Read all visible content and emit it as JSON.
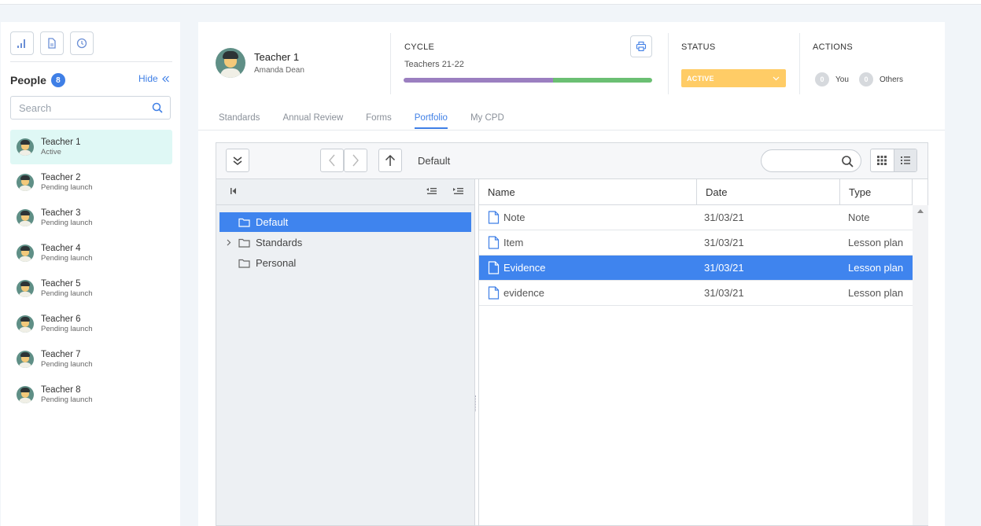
{
  "sidebar": {
    "people_label": "People",
    "people_count": "8",
    "hide_label": "Hide",
    "search_placeholder": "Search",
    "people": [
      {
        "name": "Teacher 1",
        "status": "Active"
      },
      {
        "name": "Teacher 2",
        "status": "Pending launch"
      },
      {
        "name": "Teacher 3",
        "status": "Pending launch"
      },
      {
        "name": "Teacher 4",
        "status": "Pending launch"
      },
      {
        "name": "Teacher 5",
        "status": "Pending launch"
      },
      {
        "name": "Teacher 6",
        "status": "Pending launch"
      },
      {
        "name": "Teacher 7",
        "status": "Pending launch"
      },
      {
        "name": "Teacher 8",
        "status": "Pending launch"
      }
    ]
  },
  "header": {
    "teacher_name": "Teacher 1",
    "teacher_sub": "Amanda Dean",
    "cycle_label": "CYCLE",
    "cycle_name": "Teachers 21-22",
    "status_label": "STATUS",
    "status_value": "ACTIVE",
    "actions_label": "ACTIONS",
    "you_count": "0",
    "you_label": "You",
    "others_count": "0",
    "others_label": "Others"
  },
  "tabs": [
    {
      "label": "Standards"
    },
    {
      "label": "Annual Review"
    },
    {
      "label": "Forms"
    },
    {
      "label": "Portfolio"
    },
    {
      "label": "My CPD"
    }
  ],
  "file_manager": {
    "breadcrumb": "Default",
    "search_placeholder": "",
    "tree": [
      {
        "label": "Default"
      },
      {
        "label": "Standards"
      },
      {
        "label": "Personal"
      }
    ],
    "columns": {
      "name": "Name",
      "date": "Date",
      "type": "Type"
    },
    "files": [
      {
        "name": "Note",
        "date": "31/03/21",
        "type": "Note"
      },
      {
        "name": "Item",
        "date": "31/03/21",
        "type": "Lesson plan"
      },
      {
        "name": "Evidence",
        "date": "31/03/21",
        "type": "Lesson plan"
      },
      {
        "name": "evidence",
        "date": "31/03/21",
        "type": "Lesson plan"
      }
    ]
  },
  "colors": {
    "accent": "#3f7fe6",
    "status": "#ffcc66",
    "cycle_purple": "#9b7fc0",
    "cycle_green": "#6bbf73",
    "active_person_bg": "#dff8f5"
  }
}
